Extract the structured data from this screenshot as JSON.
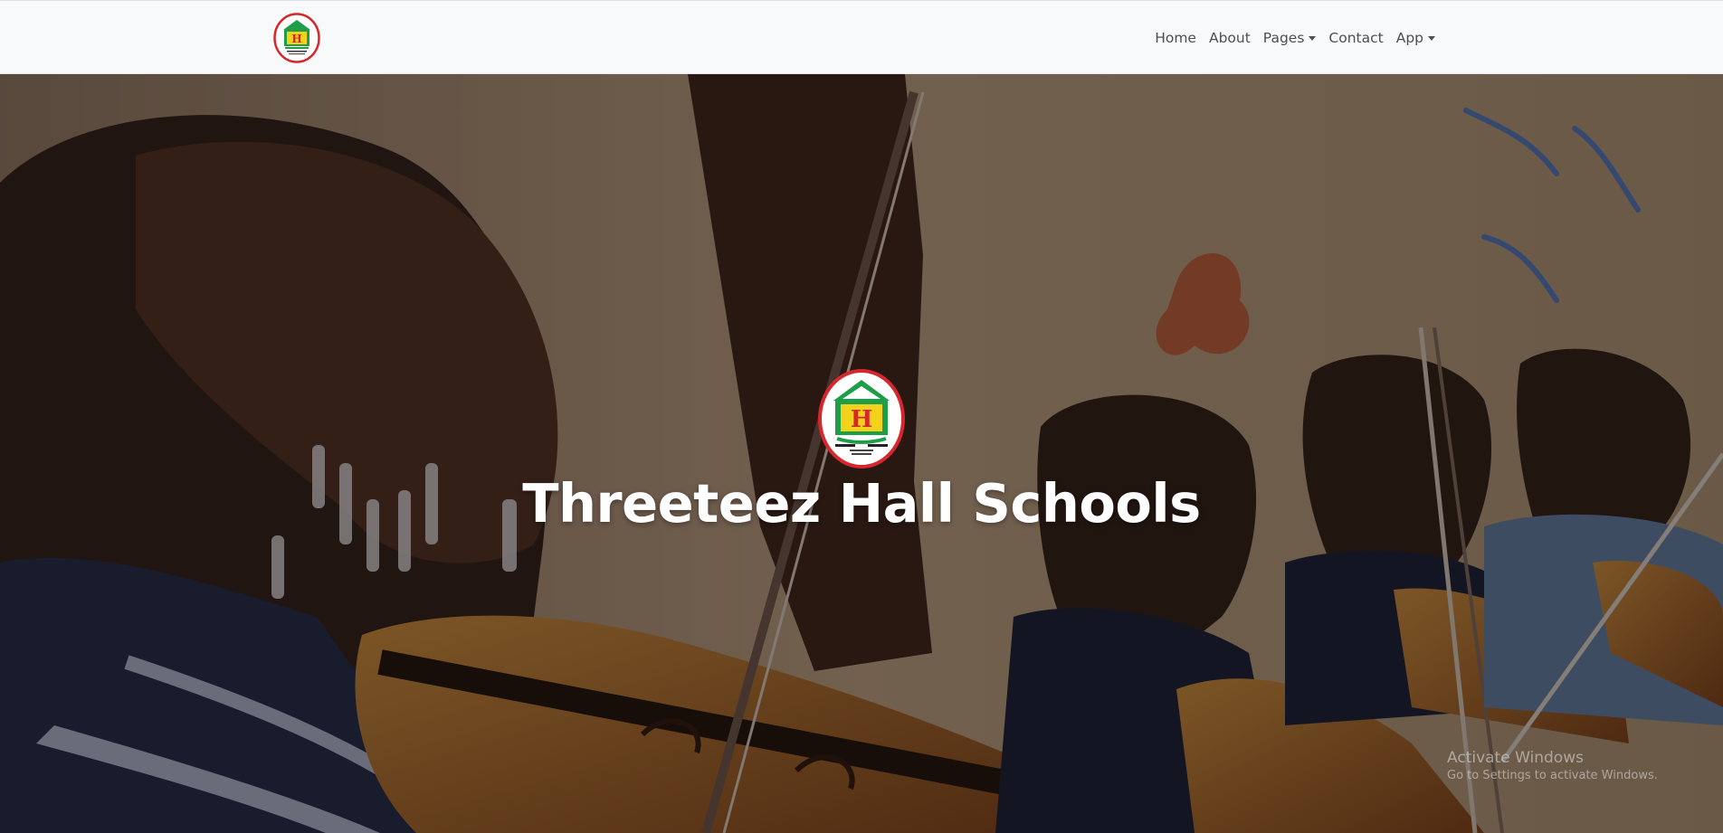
{
  "navbar": {
    "logo_icon": "school-crest-logo",
    "items": [
      {
        "label": "Home",
        "dropdown": false
      },
      {
        "label": "About",
        "dropdown": false
      },
      {
        "label": "Pages",
        "dropdown": true
      },
      {
        "label": "Contact",
        "dropdown": false
      },
      {
        "label": "App",
        "dropdown": true
      }
    ]
  },
  "hero": {
    "background_icon": "students-playing-violins-photo",
    "logo_icon": "school-crest-logo",
    "title": "Threeteez Hall Schools"
  },
  "watermark": {
    "line1": "Activate Windows",
    "line2": "Go to Settings to activate Windows."
  },
  "colors": {
    "nav_bg": "#f8f9fa",
    "nav_text": "#4a4f55",
    "crest_green": "#1f9e4a",
    "crest_yellow": "#f2d21b",
    "crest_red": "#d7262c",
    "title_text": "#ffffff"
  }
}
